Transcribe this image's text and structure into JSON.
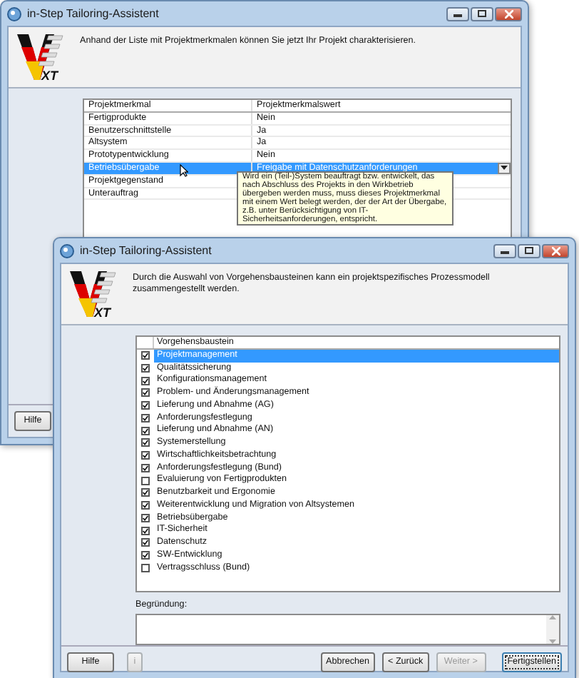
{
  "windows": [
    {
      "title": "in-Step Tailoring-Assistent",
      "logo_text": "XT",
      "intro": "Anhand der Liste mit Projektmerkmalen können Sie jetzt Ihr Projekt charakterisieren.",
      "table": {
        "columns": [
          "Projektmerkmal",
          "Projektmerkmalswert"
        ],
        "rows": [
          {
            "name": "Fertigprodukte",
            "value": "Nein",
            "selected": false
          },
          {
            "name": "Benutzerschnittstelle",
            "value": "Ja",
            "selected": false
          },
          {
            "name": "Altsystem",
            "value": "Ja",
            "selected": false
          },
          {
            "name": "Prototypentwicklung",
            "value": "Nein",
            "selected": false
          },
          {
            "name": "Betriebsübergabe",
            "value": "Freigabe mit Datenschutzanforderungen",
            "selected": true
          },
          {
            "name": "Projektgegenstand",
            "selected": false
          },
          {
            "name": "Unterauftrag",
            "selected": false
          }
        ]
      },
      "tooltip": "Wird ein (Teil-)System beauftragt bzw. entwickelt, das nach Abschluss des Projekts in den Wirkbetrieb übergeben werden muss, muss dieses Projektmerkmal mit einem Wert belegt werden, der der Art der Übergabe, z.B. unter Berücksichtigung von IT-Sicherheitsanforderungen, entspricht.",
      "buttons": [
        {
          "label": "Hilfe",
          "disabled": false,
          "default": false
        }
      ]
    },
    {
      "title": "in-Step Tailoring-Assistent",
      "logo_text": "XT",
      "intro": "Durch die Auswahl von Vorgehensbausteinen kann ein projektspezifisches Prozessmodell zusammengestellt werden.",
      "list": {
        "column": "Vorgehensbaustein",
        "items": [
          {
            "label": "Projektmanagement",
            "checked": true,
            "selected": true
          },
          {
            "label": "Qualitätssicherung",
            "checked": true,
            "selected": false
          },
          {
            "label": "Konfigurationsmanagement",
            "checked": true,
            "selected": false
          },
          {
            "label": "Problem- und Änderungsmanagement",
            "checked": true,
            "selected": false
          },
          {
            "label": "Lieferung und Abnahme (AG)",
            "checked": true,
            "selected": false
          },
          {
            "label": "Anforderungsfestlegung",
            "checked": true,
            "selected": false
          },
          {
            "label": "Lieferung und Abnahme (AN)",
            "checked": true,
            "selected": false
          },
          {
            "label": "Systemerstellung",
            "checked": true,
            "selected": false
          },
          {
            "label": "Wirtschaftlichkeitsbetrachtung",
            "checked": true,
            "selected": false
          },
          {
            "label": "Anforderungsfestlegung (Bund)",
            "checked": true,
            "selected": false
          },
          {
            "label": "Evaluierung von Fertigprodukten",
            "checked": false,
            "selected": false
          },
          {
            "label": "Benutzbarkeit und Ergonomie",
            "checked": true,
            "selected": false
          },
          {
            "label": "Weiterentwicklung und Migration von Altsystemen",
            "checked": true,
            "selected": false
          },
          {
            "label": "Betriebsübergabe",
            "checked": true,
            "selected": false
          },
          {
            "label": "IT-Sicherheit",
            "checked": true,
            "selected": false
          },
          {
            "label": "Datenschutz",
            "checked": true,
            "selected": false
          },
          {
            "label": "SW-Entwicklung",
            "checked": true,
            "selected": false
          },
          {
            "label": "Vertragsschluss (Bund)",
            "checked": false,
            "selected": false
          }
        ]
      },
      "reason_label": "Begründung:",
      "buttons": [
        {
          "label": "Hilfe",
          "disabled": false,
          "default": false
        },
        {
          "label": "i",
          "disabled": true,
          "default": false
        },
        {
          "label": "Abbrechen",
          "disabled": false,
          "default": false
        },
        {
          "label": "< Zurück",
          "disabled": false,
          "default": false
        },
        {
          "label": "Weiter >",
          "disabled": true,
          "default": false
        },
        {
          "label": "Fertigstellen",
          "disabled": false,
          "default": true
        }
      ]
    }
  ]
}
